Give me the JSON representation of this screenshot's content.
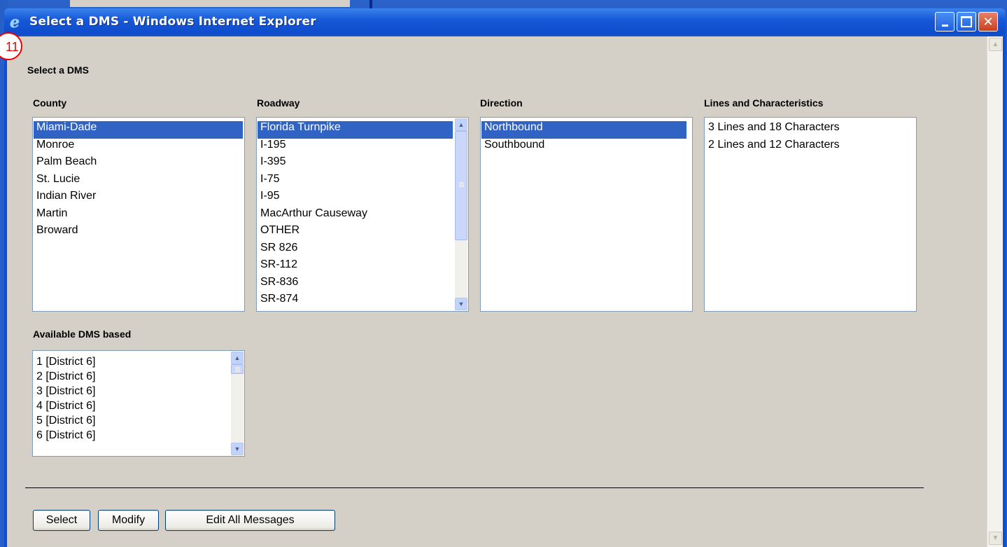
{
  "window": {
    "title": "Select a DMS - Windows Internet Explorer",
    "controls": {
      "minimize": "_",
      "maximize": "□",
      "close": "✕"
    }
  },
  "marker": {
    "number": "11"
  },
  "page": {
    "heading": "Select a DMS",
    "county": {
      "label": "County",
      "options": [
        "Miami-Dade",
        "Monroe",
        "Palm Beach",
        "St. Lucie",
        "Indian River",
        "Martin",
        "Broward"
      ],
      "selected": "Miami-Dade"
    },
    "roadway": {
      "label": "Roadway",
      "options": [
        "Florida Turnpike",
        "I-195",
        "I-395",
        "I-75",
        "I-95",
        "MacArthur Causeway",
        "OTHER",
        "SR 826",
        "SR-112",
        "SR-836",
        "SR-874"
      ],
      "selected": "Florida Turnpike"
    },
    "direction": {
      "label": "Direction",
      "options": [
        "Northbound",
        "Southbound"
      ],
      "selected": "Northbound"
    },
    "lines": {
      "label": "Lines and Characteristics",
      "options": [
        "3 Lines and 18 Characters",
        "2 Lines and 12 Characters"
      ]
    },
    "available_dms": {
      "label": "Available DMS based",
      "options": [
        "1 [District 6]",
        "2 [District 6]",
        "3 [District 6]",
        "4 [District 6]",
        "5 [District 6]",
        "6 [District 6]"
      ]
    },
    "buttons": {
      "select": "Select",
      "modify": "Modify",
      "edit_all": "Edit All Messages"
    }
  },
  "icons": {
    "ie": "internet-explorer-icon",
    "scroll_up": "chevron-up-icon",
    "scroll_down": "chevron-down-icon"
  },
  "colors": {
    "selection": "#3163c5",
    "titlebar": "#0d4ccc",
    "client_bg": "#d4d0c8"
  }
}
